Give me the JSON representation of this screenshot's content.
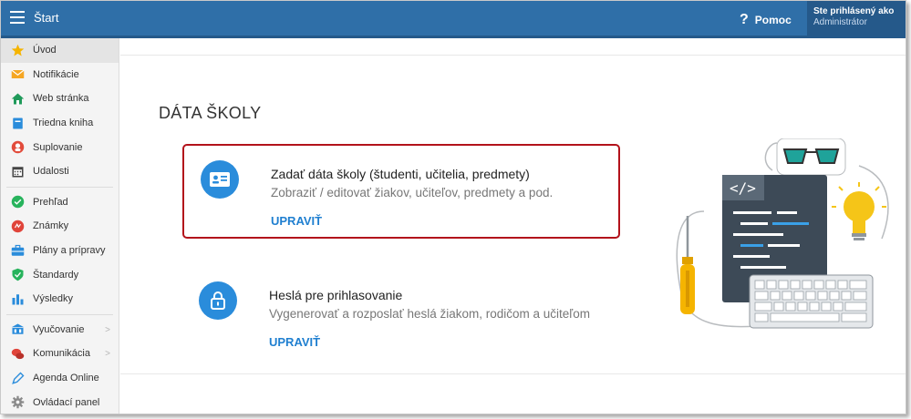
{
  "topbar": {
    "title": "Štart",
    "help_label": "Pomoc",
    "user_line1": "Ste prihlásený ako",
    "user_line2": "Administrátor"
  },
  "sidebar": {
    "items": [
      {
        "label": "Úvod",
        "icon": "star-icon"
      },
      {
        "label": "Notifikácie",
        "icon": "envelope-icon"
      },
      {
        "label": "Web stránka",
        "icon": "home-icon"
      },
      {
        "label": "Triedna kniha",
        "icon": "book-icon"
      },
      {
        "label": "Suplovanie",
        "icon": "substitute-icon"
      },
      {
        "label": "Udalosti",
        "icon": "calendar-icon"
      },
      {
        "label": "Prehľad",
        "icon": "check-circle-icon"
      },
      {
        "label": "Známky",
        "icon": "grades-icon"
      },
      {
        "label": "Plány a prípravy",
        "icon": "briefcase-icon"
      },
      {
        "label": "Štandardy",
        "icon": "shield-check-icon"
      },
      {
        "label": "Výsledky",
        "icon": "bar-chart-icon"
      },
      {
        "label": "Vyučovanie",
        "icon": "classroom-icon"
      },
      {
        "label": "Komunikácia",
        "icon": "chat-icon"
      },
      {
        "label": "Agenda Online",
        "icon": "pen-icon"
      },
      {
        "label": "Ovládací panel",
        "icon": "gear-icon"
      }
    ]
  },
  "main": {
    "section_title": "DÁTA ŠKOLY",
    "cards": [
      {
        "title": "Zadať dáta školy (študenti, učitelia, predmety)",
        "subtitle": "Zobraziť / editovať žiakov, učiteľov, predmety a pod.",
        "link": "UPRAVIŤ",
        "icon": "id-card-icon"
      },
      {
        "title": "Heslá pre prihlasovanie",
        "subtitle": "Vygenerovať a rozposlať heslá žiakom, rodičom a učiteľom",
        "link": "UPRAVIŤ",
        "icon": "lock-icon"
      }
    ],
    "illustration_code_tag": "</>"
  },
  "colors": {
    "topbar": "#2f6fa8",
    "accent": "#2a8cdb",
    "link": "#1f7fd0",
    "highlight_border": "#b3121b"
  }
}
